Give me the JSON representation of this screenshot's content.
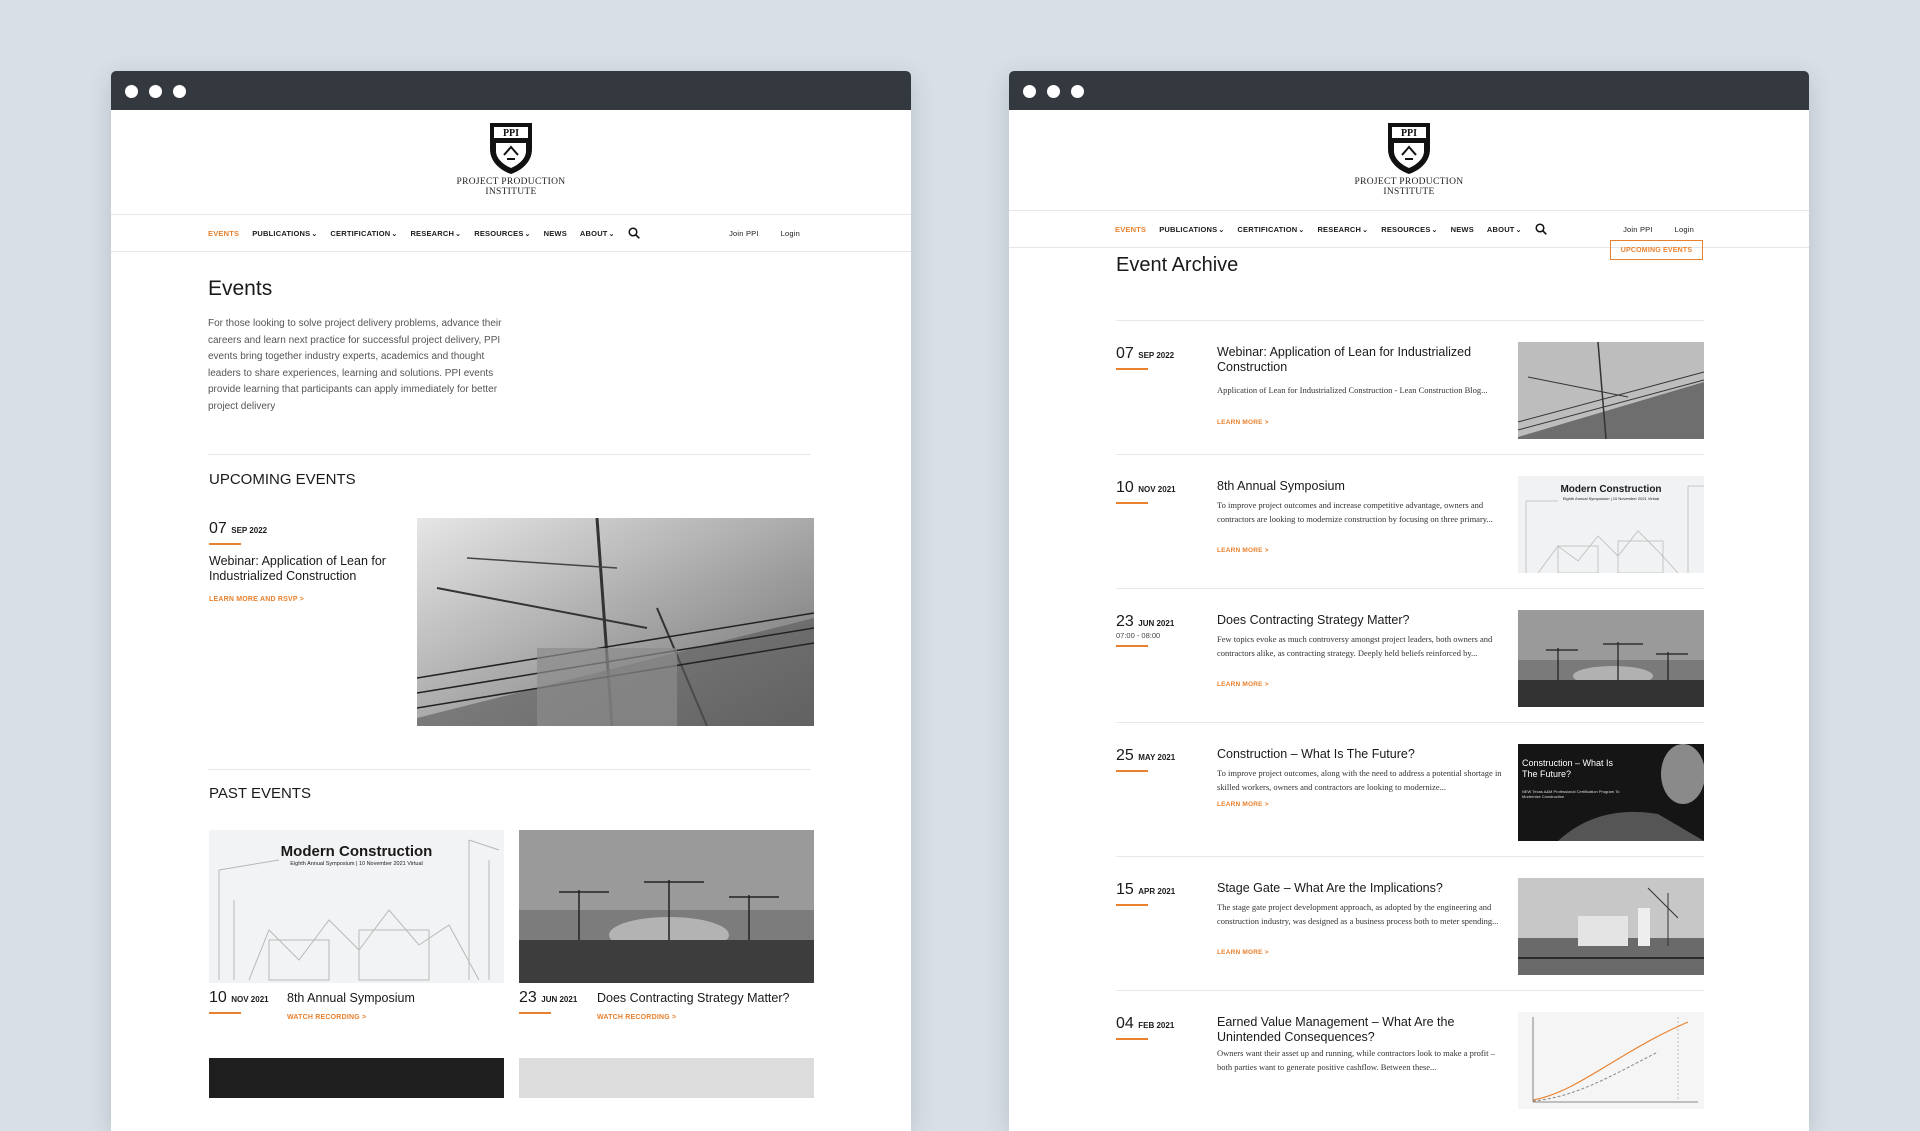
{
  "nav": {
    "items": [
      {
        "label": "EVENTS",
        "active": true,
        "chevron": false
      },
      {
        "label": "PUBLICATIONS",
        "active": false,
        "chevron": true
      },
      {
        "label": "CERTIFICATION",
        "active": false,
        "chevron": true
      },
      {
        "label": "RESEARCH",
        "active": false,
        "chevron": true
      },
      {
        "label": "RESOURCES",
        "active": false,
        "chevron": true
      },
      {
        "label": "NEWS",
        "active": false,
        "chevron": false
      },
      {
        "label": "ABOUT",
        "active": false,
        "chevron": true
      }
    ],
    "join": "Join PPI",
    "login": "Login",
    "search_icon": "search-icon"
  },
  "logo": {
    "monogram": "PPI",
    "line1": "PROJECT PRODUCTION",
    "line2": "INSTITUTE"
  },
  "colors": {
    "accent": "#e8812f",
    "titlebar": "#33393e",
    "backdrop": "#d9dfe6"
  },
  "events_page": {
    "title": "Events",
    "intro": "For those looking to solve project delivery problems, advance their careers and learn next practice for successful project delivery, PPI events bring together industry experts, academics and thought leaders to share experiences, learning and solutions. PPI events provide learning that participants can apply immediately for better project delivery",
    "upcoming_heading": "UPCOMING EVENTS",
    "upcoming": {
      "day": "07",
      "month": "SEP 2022",
      "title": "Webinar: Application of Lean for Industrialized Construction",
      "cta": "LEARN MORE AND RSVP >"
    },
    "past_heading": "PAST EVENTS",
    "past": [
      {
        "day": "10",
        "month": "NOV 2021",
        "title": "8th Annual Symposium",
        "cta": "WATCH RECORDING >",
        "image_title": "Modern Construction",
        "image_sub": "Eighth Annual Symposium | 10 November 2021 Virtual"
      },
      {
        "day": "23",
        "month": "JUN 2021",
        "title": "Does Contracting Strategy Matter?",
        "cta": "WATCH RECORDING >"
      }
    ]
  },
  "archive_page": {
    "title": "Event Archive",
    "button": "UPCOMING EVENTS",
    "rows": [
      {
        "day": "07",
        "month": "SEP 2022",
        "time": "",
        "title": "Webinar: Application of Lean for Industrialized Construction",
        "desc": "Application of Lean for Industrialized Construction - Lean Construction Blog...",
        "cta": "LEARN MORE >",
        "thumb_title": "",
        "thumb_sub": ""
      },
      {
        "day": "10",
        "month": "NOV 2021",
        "time": "",
        "title": "8th Annual Symposium",
        "desc": "To improve project outcomes and increase competitive advantage, owners and contractors are looking to modernize construction by focusing on three primary...",
        "cta": "LEARN MORE >",
        "thumb_title": "Modern Construction",
        "thumb_sub": "Eighth Annual Symposium | 10 November 2021 Virtual"
      },
      {
        "day": "23",
        "month": "JUN 2021",
        "time": "07:00 - 08:00",
        "title": "Does Contracting Strategy Matter?",
        "desc": "Few topics evoke as much controversy amongst project leaders, both owners and contractors alike, as contracting strategy. Deeply held beliefs reinforced by...",
        "cta": "LEARN MORE >",
        "thumb_title": "",
        "thumb_sub": ""
      },
      {
        "day": "25",
        "month": "MAY 2021",
        "time": "",
        "title": "Construction – What Is The Future?",
        "desc": "To improve project outcomes, along with the need to address a potential shortage in skilled workers, owners and contractors are looking to modernize...",
        "cta": "LEARN MORE >",
        "thumb_title": "Construction – What Is The Future?",
        "thumb_sub": "NEW Texas A&M Professional Certification Program To Modernize Construction"
      },
      {
        "day": "15",
        "month": "APR 2021",
        "time": "",
        "title": "Stage Gate – What Are the Implications?",
        "desc": "The stage gate project development approach, as adopted by the engineering and construction industry, was designed as a business process both to meter spending...",
        "cta": "LEARN MORE >",
        "thumb_title": "",
        "thumb_sub": ""
      },
      {
        "day": "04",
        "month": "FEB 2021",
        "time": "",
        "title": "Earned Value Management – What Are the Unintended Consequences?",
        "desc": "Owners want their asset up and running, while contractors look to make a profit – both parties want to generate positive cashflow. Between these...",
        "cta": "",
        "thumb_title": "",
        "thumb_sub": ""
      }
    ]
  }
}
